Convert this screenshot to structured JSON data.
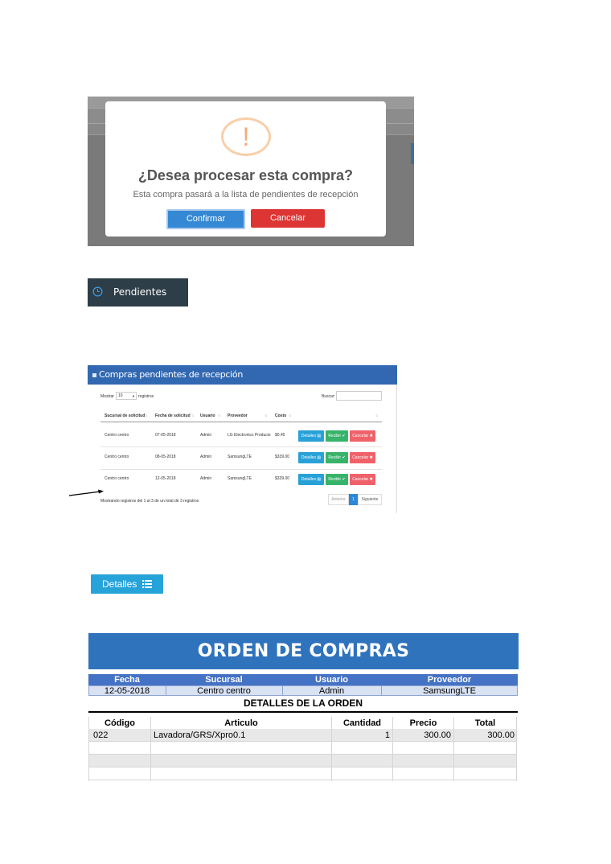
{
  "confirm_dialog": {
    "icon": "exclamation",
    "icon_glyph": "!",
    "title": "¿Desea procesar esta compra?",
    "message": "Esta compra pasará a la lista de pendientes de recepción",
    "confirm_label": "Confirmar",
    "cancel_label": "Cancelar",
    "colors": {
      "confirm": "#3588d4",
      "cancel": "#dd3434",
      "icon": "#f5a974"
    }
  },
  "menu_item": {
    "icon": "clock-icon",
    "label": "Pendientes",
    "background": "#2e3e48"
  },
  "pending_panel": {
    "title": "Compras pendientes de recepción",
    "show_label": "Mostrar",
    "show_value": "10",
    "show_suffix": "registros",
    "search_label": "Buscar:",
    "columns": [
      "Sucursal de solicitud",
      "Fecha de solicitud",
      "Usuario",
      "Proveedor",
      "Costo"
    ],
    "rows": [
      {
        "sucursal": "Centro centro",
        "fecha": "07-05-2018",
        "usuario": "Admin",
        "proveedor": "LG Electronics Products",
        "costo": "$0.45"
      },
      {
        "sucursal": "Centro centro",
        "fecha": "08-05-2018",
        "usuario": "Admin",
        "proveedor": "SamsungLTE",
        "costo": "$339.00"
      },
      {
        "sucursal": "Centro centro",
        "fecha": "12-05-2018",
        "usuario": "Admin",
        "proveedor": "SamsungLTE",
        "costo": "$339.00"
      }
    ],
    "row_actions": {
      "details": "Detalles",
      "receive": "Recibir",
      "cancel": "Cancelar"
    },
    "info": "Mostrando registros del 1 al 3 de un total de 3 registros",
    "pagination": {
      "prev": "Anterior",
      "current": "1",
      "next": "Siguiente"
    }
  },
  "details_button": {
    "label": "Detalles",
    "icon": "list-icon"
  },
  "order_document": {
    "title": "ORDEN DE COMPRAS",
    "info_headers": [
      "Fecha",
      "Sucursal",
      "Usuario",
      "Proveedor"
    ],
    "info_values": [
      "12-05-2018",
      "Centro centro",
      "Admin",
      "SamsungLTE"
    ],
    "details_title": "DETALLES DE LA ORDEN",
    "item_headers": [
      "Código",
      "Articulo",
      "Cantidad",
      "Precio",
      "Total"
    ],
    "items": [
      {
        "codigo": "022",
        "articulo": "Lavadora/GRS/Xpro0.1",
        "cantidad": "1",
        "precio": "300.00",
        "total": "300.00"
      }
    ]
  }
}
